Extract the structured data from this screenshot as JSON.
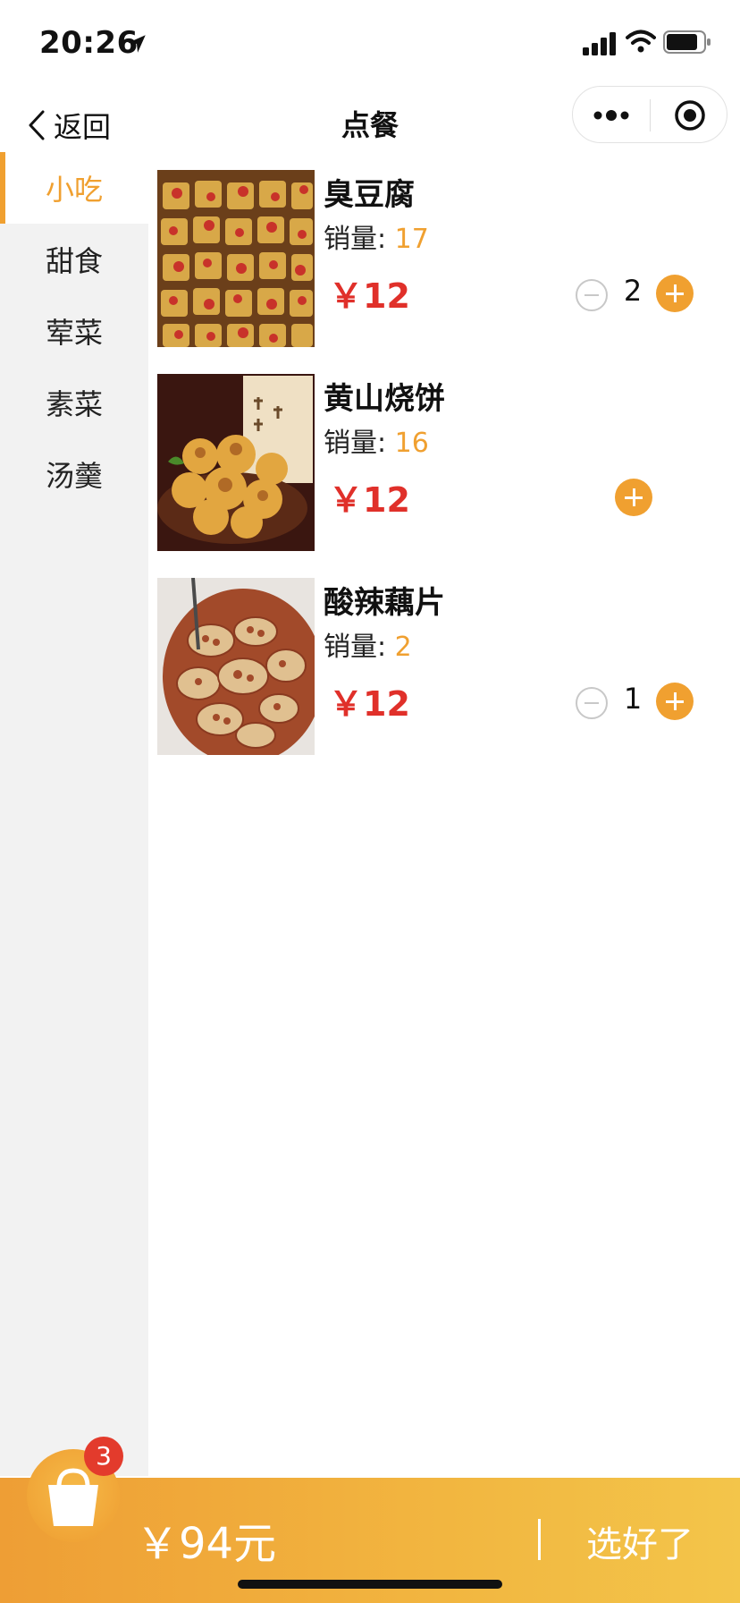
{
  "status_bar": {
    "time": "20:26"
  },
  "nav": {
    "back_label": "返回",
    "title": "点餐"
  },
  "sidebar": {
    "items": [
      {
        "label": "小吃",
        "active": true
      },
      {
        "label": "甜食",
        "active": false
      },
      {
        "label": "荤菜",
        "active": false
      },
      {
        "label": "素菜",
        "active": false
      },
      {
        "label": "汤羹",
        "active": false
      }
    ]
  },
  "foods": [
    {
      "name": "臭豆腐",
      "sales_label": "销量: ",
      "sales": "17",
      "price": "￥12",
      "quantity": "2"
    },
    {
      "name": "黄山烧饼",
      "sales_label": "销量: ",
      "sales": "16",
      "price": "￥12",
      "quantity": ""
    },
    {
      "name": "酸辣藕片",
      "sales_label": "销量: ",
      "sales": "2",
      "price": "￥12",
      "quantity": "1"
    }
  ],
  "cart": {
    "badge_count": "3",
    "total": "￥94元",
    "checkout_label": "选好了"
  },
  "colors": {
    "accent": "#f0a030",
    "price_red": "#e0302a",
    "badge_red": "#e33b2c",
    "sidebar_bg": "#f2f2f2"
  }
}
